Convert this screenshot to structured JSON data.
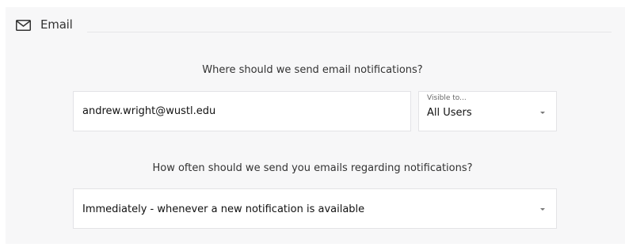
{
  "section": {
    "title": "Email",
    "icon": "envelope-icon"
  },
  "email_question": "Where should we send email notifications?",
  "email_field": {
    "value": "andrew.wright@wustl.edu"
  },
  "visibility_select": {
    "label": "Visible to...",
    "value": "All Users",
    "icon": "chevron-down-icon"
  },
  "frequency_question": "How often should we send you emails regarding notifications?",
  "frequency_select": {
    "value": "Immediately - whenever a new notification is available",
    "icon": "chevron-down-icon"
  }
}
